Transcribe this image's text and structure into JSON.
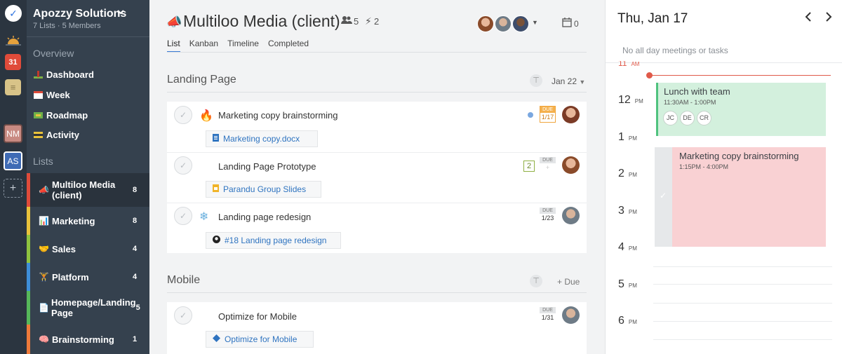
{
  "rail": {
    "check_glyph": "✓",
    "calendar_glyph": "31",
    "nm_label": "NM",
    "as_label": "AS",
    "add_glyph": "+"
  },
  "sidebar": {
    "org_name": "Apozzy Solutions",
    "org_sub": "7 Lists · 5 Members",
    "overview_heading": "Overview",
    "overview_items": [
      {
        "label": "Dashboard",
        "icon": "chart-icon"
      },
      {
        "label": "Week",
        "icon": "calendar-week-icon"
      },
      {
        "label": "Roadmap",
        "icon": "map-icon"
      },
      {
        "label": "Activity",
        "icon": "activity-icon"
      }
    ],
    "lists_heading": "Lists",
    "lists": [
      {
        "label": "Multiloo Media (client)",
        "count": "8",
        "color": "#e04b3a",
        "glyph": "📣"
      },
      {
        "label": "Marketing",
        "count": "8",
        "color": "#e9c23b",
        "glyph": "📊"
      },
      {
        "label": "Sales",
        "count": "4",
        "color": "#8fc33f",
        "glyph": "🤝"
      },
      {
        "label": "Platform",
        "count": "4",
        "color": "#3e8ed8",
        "glyph": "🏋"
      },
      {
        "label": "Homepage/Landing Page",
        "count": "5",
        "color": "#56b85a",
        "glyph": "📄"
      },
      {
        "label": "Brainstorming",
        "count": "1",
        "color": "#ef7a3a",
        "glyph": "🧠"
      }
    ]
  },
  "header": {
    "title": "Multiloo Media (client)",
    "members_count": "5",
    "bolt_count": "2",
    "calendar_count": "0"
  },
  "tabs": [
    "List",
    "Kanban",
    "Timeline",
    "Completed"
  ],
  "sections": [
    {
      "title": "Landing Page",
      "meta": "Jan 22",
      "tasks": [
        {
          "title": "Marketing copy brainstorming",
          "emoji": "🔥",
          "attachment": "Marketing copy.docx",
          "attachment_icon": "doc-icon",
          "due_label": "DUE",
          "due_value": "1/17"
        },
        {
          "title": "Landing Page Prototype",
          "emoji": "",
          "attachment": "Parandu Group Slides",
          "attachment_icon": "slides-icon",
          "due_label": "DUE",
          "due_value": "+",
          "count": "2"
        },
        {
          "title": "Landing page redesign",
          "emoji": "❄",
          "attachment": "#18 Landing page redesign",
          "attachment_icon": "github-icon",
          "due_label": "DUE",
          "due_value": "1/23"
        }
      ]
    },
    {
      "title": "Mobile",
      "meta": "+ Due",
      "tasks": [
        {
          "title": "Optimize for Mobile",
          "emoji": "",
          "attachment": "Optimize for Mobile",
          "attachment_icon": "diamond-icon",
          "due_label": "DUE",
          "due_value": "1/31"
        }
      ]
    }
  ],
  "calendar": {
    "date": "Thu, Jan 17",
    "empty_text": "No all day meetings or tasks",
    "hours": [
      {
        "hour": "11",
        "ampm": "AM"
      },
      {
        "hour": "12",
        "ampm": "PM"
      },
      {
        "hour": "1",
        "ampm": "PM"
      },
      {
        "hour": "2",
        "ampm": "PM"
      },
      {
        "hour": "3",
        "ampm": "PM"
      },
      {
        "hour": "4",
        "ampm": "PM"
      },
      {
        "hour": "5",
        "ampm": "PM"
      },
      {
        "hour": "6",
        "ampm": "PM"
      }
    ],
    "events": [
      {
        "title": "Lunch with team",
        "time": "11:30AM - 1:00PM",
        "attendees": [
          "JC",
          "DE",
          "CR"
        ],
        "color": "#d3f0dd"
      },
      {
        "title": "Marketing copy brainstorming",
        "time": "1:15PM - 4:00PM",
        "color": "#f9d1d3"
      }
    ]
  }
}
